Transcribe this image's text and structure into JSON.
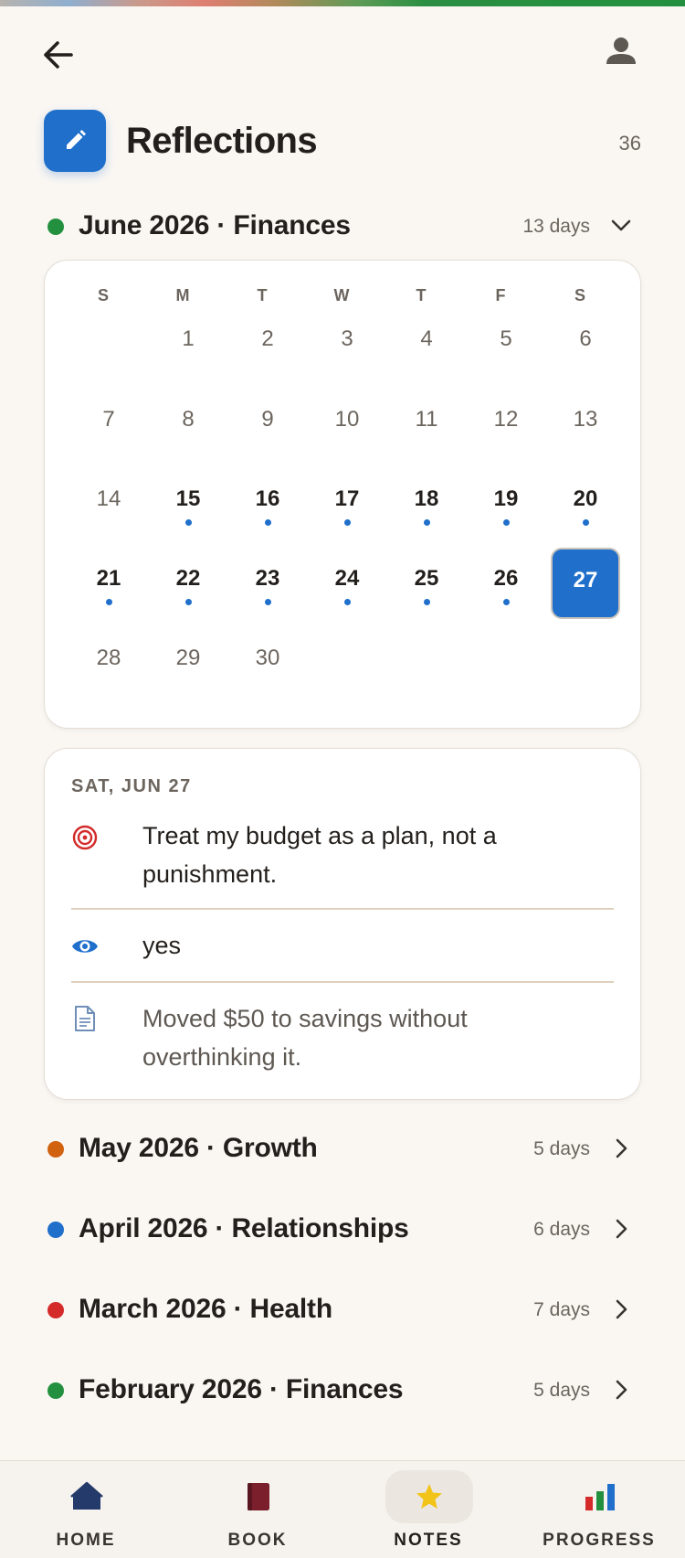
{
  "header": {
    "title": "Reflections",
    "count": "36"
  },
  "colors": {
    "accent": "#1f6fcb",
    "finances": "#23903f",
    "growth": "#d1620f",
    "relationships": "#1f6fcb",
    "health": "#d42a2a"
  },
  "current_month": {
    "label": "June 2026 · Finances",
    "days": "13 days",
    "dot_color": "#23903f"
  },
  "calendar": {
    "weekdays": [
      "S",
      "M",
      "T",
      "W",
      "T",
      "F",
      "S"
    ],
    "weeks": [
      [
        null,
        {
          "d": "1"
        },
        {
          "d": "2"
        },
        {
          "d": "3"
        },
        {
          "d": "4"
        },
        {
          "d": "5"
        },
        {
          "d": "6"
        }
      ],
      [
        {
          "d": "7"
        },
        {
          "d": "8"
        },
        {
          "d": "9"
        },
        {
          "d": "10"
        },
        {
          "d": "11"
        },
        {
          "d": "12"
        },
        {
          "d": "13"
        }
      ],
      [
        {
          "d": "14"
        },
        {
          "d": "15",
          "e": true
        },
        {
          "d": "16",
          "e": true
        },
        {
          "d": "17",
          "e": true
        },
        {
          "d": "18",
          "e": true
        },
        {
          "d": "19",
          "e": true
        },
        {
          "d": "20",
          "e": true
        }
      ],
      [
        {
          "d": "21",
          "e": true
        },
        {
          "d": "22",
          "e": true
        },
        {
          "d": "23",
          "e": true
        },
        {
          "d": "24",
          "e": true
        },
        {
          "d": "25",
          "e": true
        },
        {
          "d": "26",
          "e": true
        },
        {
          "d": "27",
          "s": true
        }
      ],
      [
        {
          "d": "28"
        },
        {
          "d": "29"
        },
        {
          "d": "30"
        },
        null,
        null,
        null,
        null
      ]
    ]
  },
  "entry": {
    "date": "SAT, JUN 27",
    "intention": "Treat my budget as a plan, not a punishment.",
    "observed": "yes",
    "note": "Moved $50 to savings without overthinking it."
  },
  "months": [
    {
      "label": "May 2026 · Growth",
      "days": "5 days",
      "color": "#d1620f"
    },
    {
      "label": "April 2026 · Relationships",
      "days": "6 days",
      "color": "#1f6fcb"
    },
    {
      "label": "March 2026 · Health",
      "days": "7 days",
      "color": "#d42a2a"
    },
    {
      "label": "February 2026 · Finances",
      "days": "5 days",
      "color": "#23903f"
    }
  ],
  "nav": {
    "home": "HOME",
    "book": "BOOK",
    "notes": "NOTES",
    "progress": "PROGRESS"
  }
}
